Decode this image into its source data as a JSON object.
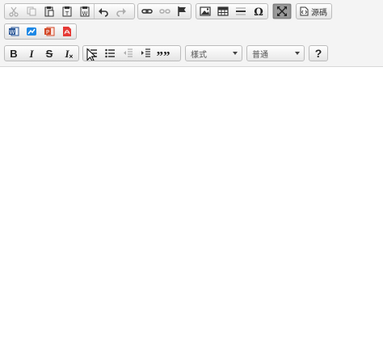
{
  "toolbar": {
    "row1": {
      "clipboard_group": [
        "cut-icon",
        "copy-icon",
        "paste-icon",
        "paste-text-icon",
        "paste-from-word-icon",
        "undo-icon",
        "redo-icon"
      ],
      "link_group": [
        "link-icon",
        "unlink-icon",
        "anchor-icon"
      ],
      "insert_group": [
        "image-icon",
        "table-icon",
        "horizontal-rule-icon",
        "special-char-icon"
      ],
      "tools_group": [
        "maximize-icon"
      ],
      "source_label": "源碼"
    },
    "row2": {
      "import_group": [
        "word-import-icon",
        "excel-import-icon",
        "powerpoint-import-icon",
        "pdf-import-icon"
      ]
    },
    "row3": {
      "bold_label": "B",
      "italic_label": "I",
      "strike_label": "S",
      "remove_format_label": "I",
      "blockquote_label": "””",
      "styles_combo": "樣式",
      "format_combo": "普通",
      "help_label": "?"
    }
  },
  "colors": {
    "toolbar_bg": "#f4f4f4",
    "active_button": "#9a9a9a",
    "word_blue": "#2b5797",
    "excel_blue": "#1e88e5",
    "ppt_orange": "#d24726",
    "pdf_red": "#e53935"
  }
}
